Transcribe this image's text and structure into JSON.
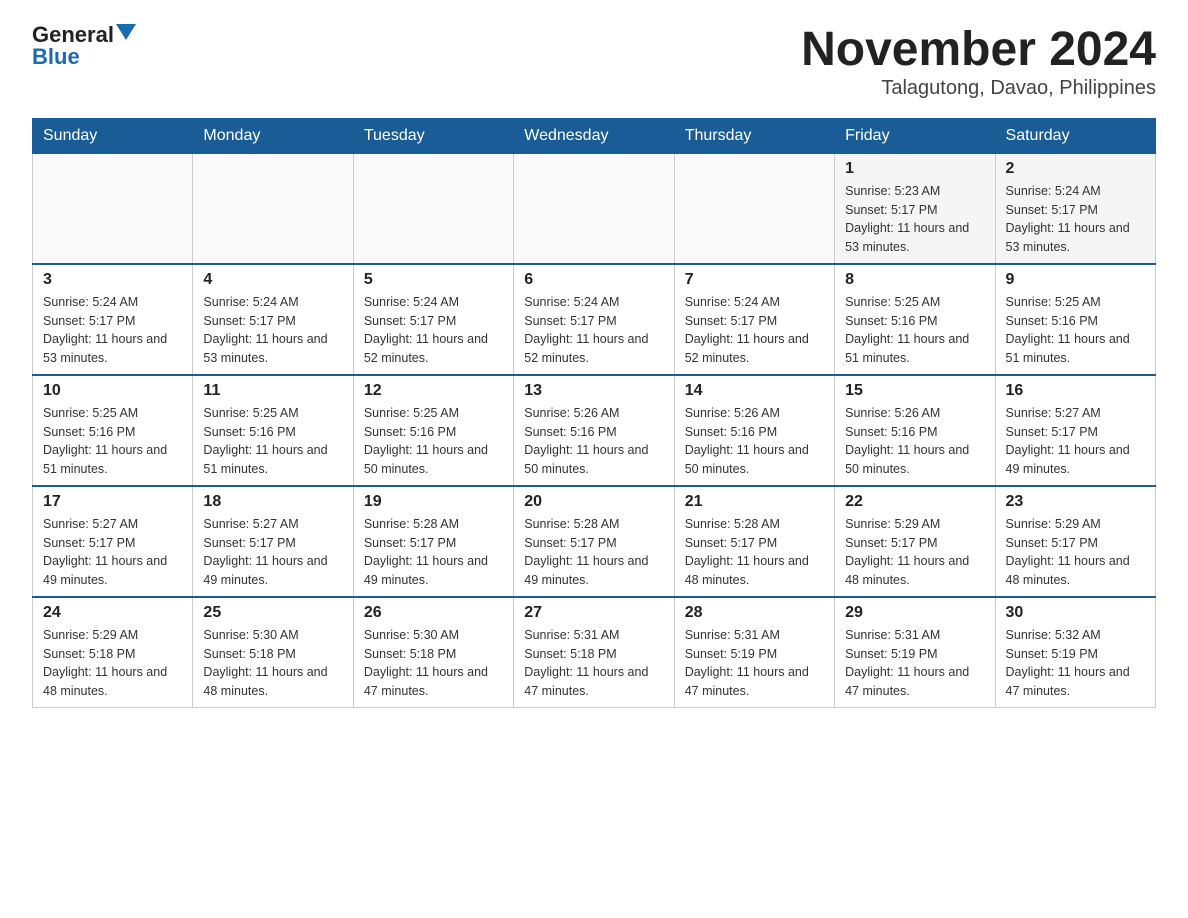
{
  "logo": {
    "general": "General",
    "blue": "Blue"
  },
  "title": "November 2024",
  "subtitle": "Talagutong, Davao, Philippines",
  "days_of_week": [
    "Sunday",
    "Monday",
    "Tuesday",
    "Wednesday",
    "Thursday",
    "Friday",
    "Saturday"
  ],
  "weeks": [
    [
      {
        "day": "",
        "info": ""
      },
      {
        "day": "",
        "info": ""
      },
      {
        "day": "",
        "info": ""
      },
      {
        "day": "",
        "info": ""
      },
      {
        "day": "",
        "info": ""
      },
      {
        "day": "1",
        "info": "Sunrise: 5:23 AM\nSunset: 5:17 PM\nDaylight: 11 hours and 53 minutes."
      },
      {
        "day": "2",
        "info": "Sunrise: 5:24 AM\nSunset: 5:17 PM\nDaylight: 11 hours and 53 minutes."
      }
    ],
    [
      {
        "day": "3",
        "info": "Sunrise: 5:24 AM\nSunset: 5:17 PM\nDaylight: 11 hours and 53 minutes."
      },
      {
        "day": "4",
        "info": "Sunrise: 5:24 AM\nSunset: 5:17 PM\nDaylight: 11 hours and 53 minutes."
      },
      {
        "day": "5",
        "info": "Sunrise: 5:24 AM\nSunset: 5:17 PM\nDaylight: 11 hours and 52 minutes."
      },
      {
        "day": "6",
        "info": "Sunrise: 5:24 AM\nSunset: 5:17 PM\nDaylight: 11 hours and 52 minutes."
      },
      {
        "day": "7",
        "info": "Sunrise: 5:24 AM\nSunset: 5:17 PM\nDaylight: 11 hours and 52 minutes."
      },
      {
        "day": "8",
        "info": "Sunrise: 5:25 AM\nSunset: 5:16 PM\nDaylight: 11 hours and 51 minutes."
      },
      {
        "day": "9",
        "info": "Sunrise: 5:25 AM\nSunset: 5:16 PM\nDaylight: 11 hours and 51 minutes."
      }
    ],
    [
      {
        "day": "10",
        "info": "Sunrise: 5:25 AM\nSunset: 5:16 PM\nDaylight: 11 hours and 51 minutes."
      },
      {
        "day": "11",
        "info": "Sunrise: 5:25 AM\nSunset: 5:16 PM\nDaylight: 11 hours and 51 minutes."
      },
      {
        "day": "12",
        "info": "Sunrise: 5:25 AM\nSunset: 5:16 PM\nDaylight: 11 hours and 50 minutes."
      },
      {
        "day": "13",
        "info": "Sunrise: 5:26 AM\nSunset: 5:16 PM\nDaylight: 11 hours and 50 minutes."
      },
      {
        "day": "14",
        "info": "Sunrise: 5:26 AM\nSunset: 5:16 PM\nDaylight: 11 hours and 50 minutes."
      },
      {
        "day": "15",
        "info": "Sunrise: 5:26 AM\nSunset: 5:16 PM\nDaylight: 11 hours and 50 minutes."
      },
      {
        "day": "16",
        "info": "Sunrise: 5:27 AM\nSunset: 5:17 PM\nDaylight: 11 hours and 49 minutes."
      }
    ],
    [
      {
        "day": "17",
        "info": "Sunrise: 5:27 AM\nSunset: 5:17 PM\nDaylight: 11 hours and 49 minutes."
      },
      {
        "day": "18",
        "info": "Sunrise: 5:27 AM\nSunset: 5:17 PM\nDaylight: 11 hours and 49 minutes."
      },
      {
        "day": "19",
        "info": "Sunrise: 5:28 AM\nSunset: 5:17 PM\nDaylight: 11 hours and 49 minutes."
      },
      {
        "day": "20",
        "info": "Sunrise: 5:28 AM\nSunset: 5:17 PM\nDaylight: 11 hours and 49 minutes."
      },
      {
        "day": "21",
        "info": "Sunrise: 5:28 AM\nSunset: 5:17 PM\nDaylight: 11 hours and 48 minutes."
      },
      {
        "day": "22",
        "info": "Sunrise: 5:29 AM\nSunset: 5:17 PM\nDaylight: 11 hours and 48 minutes."
      },
      {
        "day": "23",
        "info": "Sunrise: 5:29 AM\nSunset: 5:17 PM\nDaylight: 11 hours and 48 minutes."
      }
    ],
    [
      {
        "day": "24",
        "info": "Sunrise: 5:29 AM\nSunset: 5:18 PM\nDaylight: 11 hours and 48 minutes."
      },
      {
        "day": "25",
        "info": "Sunrise: 5:30 AM\nSunset: 5:18 PM\nDaylight: 11 hours and 48 minutes."
      },
      {
        "day": "26",
        "info": "Sunrise: 5:30 AM\nSunset: 5:18 PM\nDaylight: 11 hours and 47 minutes."
      },
      {
        "day": "27",
        "info": "Sunrise: 5:31 AM\nSunset: 5:18 PM\nDaylight: 11 hours and 47 minutes."
      },
      {
        "day": "28",
        "info": "Sunrise: 5:31 AM\nSunset: 5:19 PM\nDaylight: 11 hours and 47 minutes."
      },
      {
        "day": "29",
        "info": "Sunrise: 5:31 AM\nSunset: 5:19 PM\nDaylight: 11 hours and 47 minutes."
      },
      {
        "day": "30",
        "info": "Sunrise: 5:32 AM\nSunset: 5:19 PM\nDaylight: 11 hours and 47 minutes."
      }
    ]
  ]
}
